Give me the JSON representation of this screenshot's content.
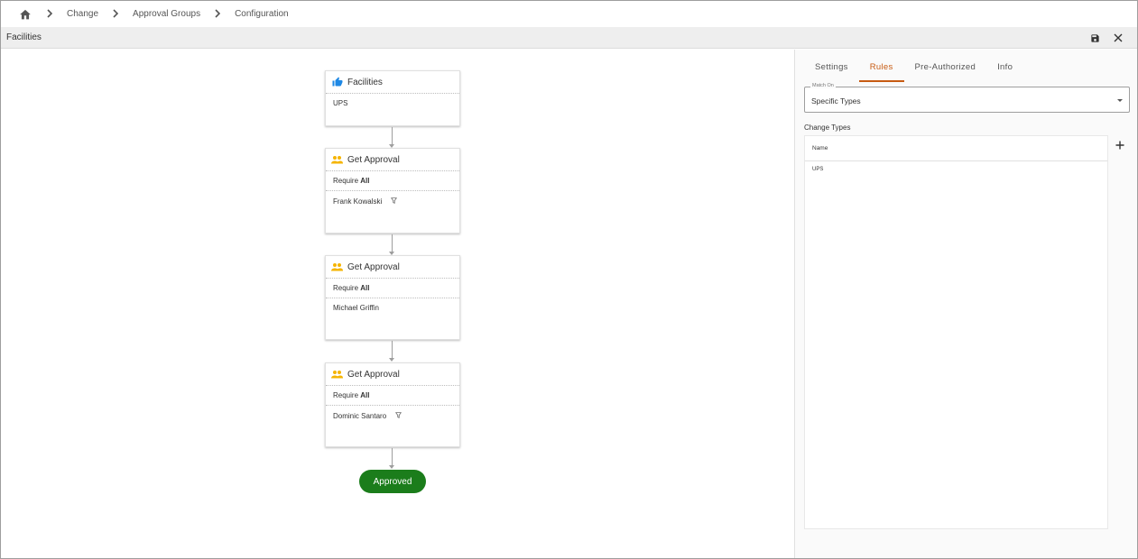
{
  "breadcrumb": {
    "items": [
      "Change",
      "Approval Groups",
      "Configuration"
    ]
  },
  "header": {
    "title": "Facilities"
  },
  "workflow": {
    "start": {
      "title": "Facilities",
      "type": "UPS"
    },
    "steps": [
      {
        "title": "Get Approval",
        "require_prefix": "Require",
        "require_value": "All",
        "approver": "Frank Kowalski",
        "filtered": true
      },
      {
        "title": "Get Approval",
        "require_prefix": "Require",
        "require_value": "All",
        "approver": "Michael Griffin",
        "filtered": false
      },
      {
        "title": "Get Approval",
        "require_prefix": "Require",
        "require_value": "All",
        "approver": "Dominic Santaro",
        "filtered": true
      }
    ],
    "end_label": "Approved"
  },
  "panel": {
    "tabs": [
      "Settings",
      "Rules",
      "Pre-Authorized",
      "Info"
    ],
    "active_tab": "Rules",
    "match_on": {
      "label": "Match On",
      "value": "Specific Types"
    },
    "change_types": {
      "label": "Change Types",
      "column": "Name",
      "rows": [
        "UPS"
      ]
    }
  },
  "colors": {
    "accent": "#c75b12",
    "approved": "#1b7d1b",
    "thumbs_icon": "#1e88e5",
    "group_icon": "#f5b400"
  },
  "icons": {
    "home": "home-icon",
    "separator": "chevron-right-icon",
    "save": "save-icon",
    "close": "close-icon",
    "start": "thumbs-up-icon",
    "step": "group-icon",
    "filter": "filter-icon",
    "add": "add-icon"
  }
}
